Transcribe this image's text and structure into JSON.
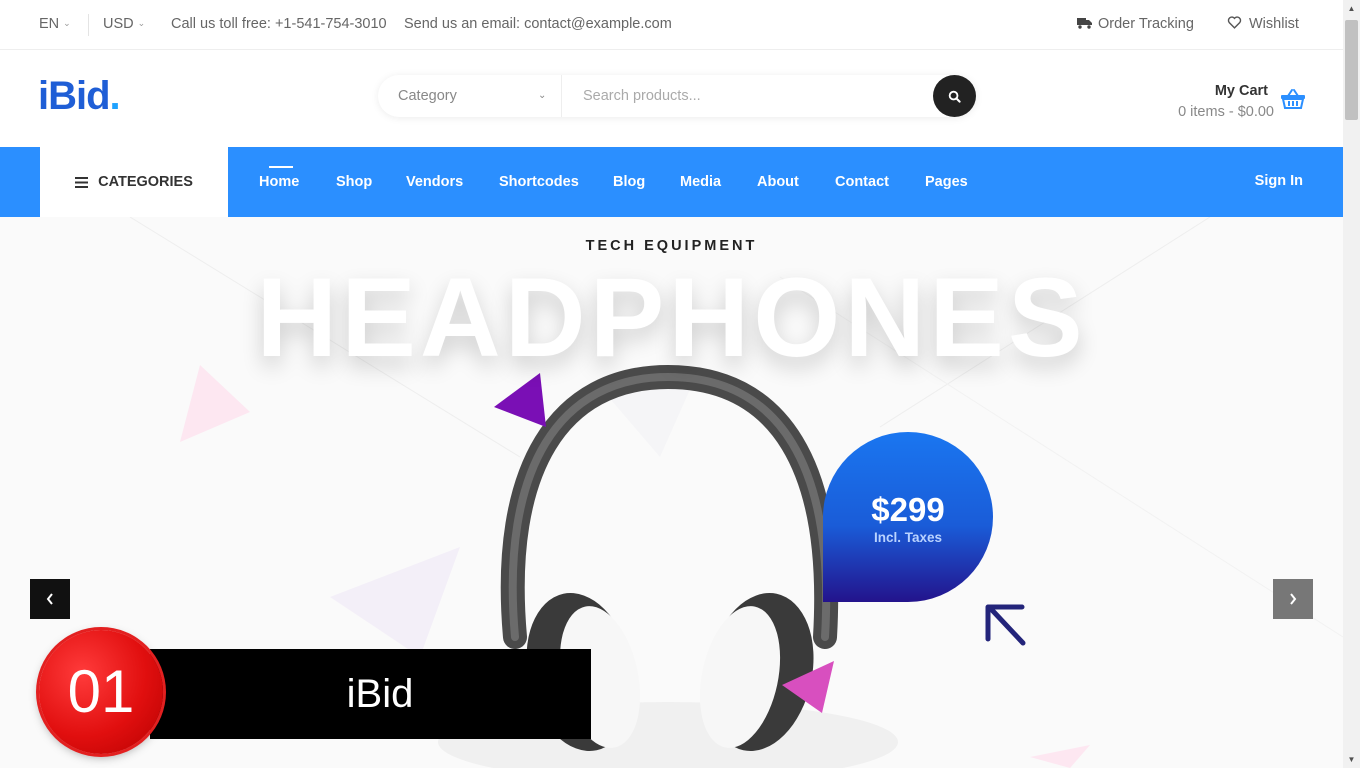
{
  "topbar": {
    "language": "EN",
    "currency": "USD",
    "phone": "Call us toll free: +1-541-754-3010",
    "email": "Send us an email: contact@example.com",
    "order_tracking": "Order Tracking",
    "wishlist": "Wishlist"
  },
  "header": {
    "logo": "iBid",
    "logo_dot": ".",
    "category_select": "Category",
    "search_placeholder": "Search products...",
    "cart_title": "My Cart",
    "cart_summary": "0 items - $0.00"
  },
  "nav": {
    "categories": "CATEGORIES",
    "items": [
      "Home",
      "Shop",
      "Vendors",
      "Shortcodes",
      "Blog",
      "Media",
      "About",
      "Contact",
      "Pages"
    ],
    "sign_in": "Sign In"
  },
  "hero": {
    "eyebrow": "TECH EQUIPMENT",
    "headline": "HEADPHONES",
    "price": "$299",
    "price_note": "Incl. Taxes"
  },
  "overlay": {
    "number": "01",
    "title": "iBid"
  },
  "colors": {
    "brand_blue": "#2b8fff",
    "logo_blue": "#1f5ed6",
    "badge_red": "#e10f0f"
  },
  "icons": [
    "chevron-down-icon",
    "truck-icon",
    "heart-icon",
    "search-icon",
    "basket-icon",
    "menu-icon",
    "chevron-left-icon",
    "chevron-right-icon",
    "arrow-up-left-icon"
  ]
}
